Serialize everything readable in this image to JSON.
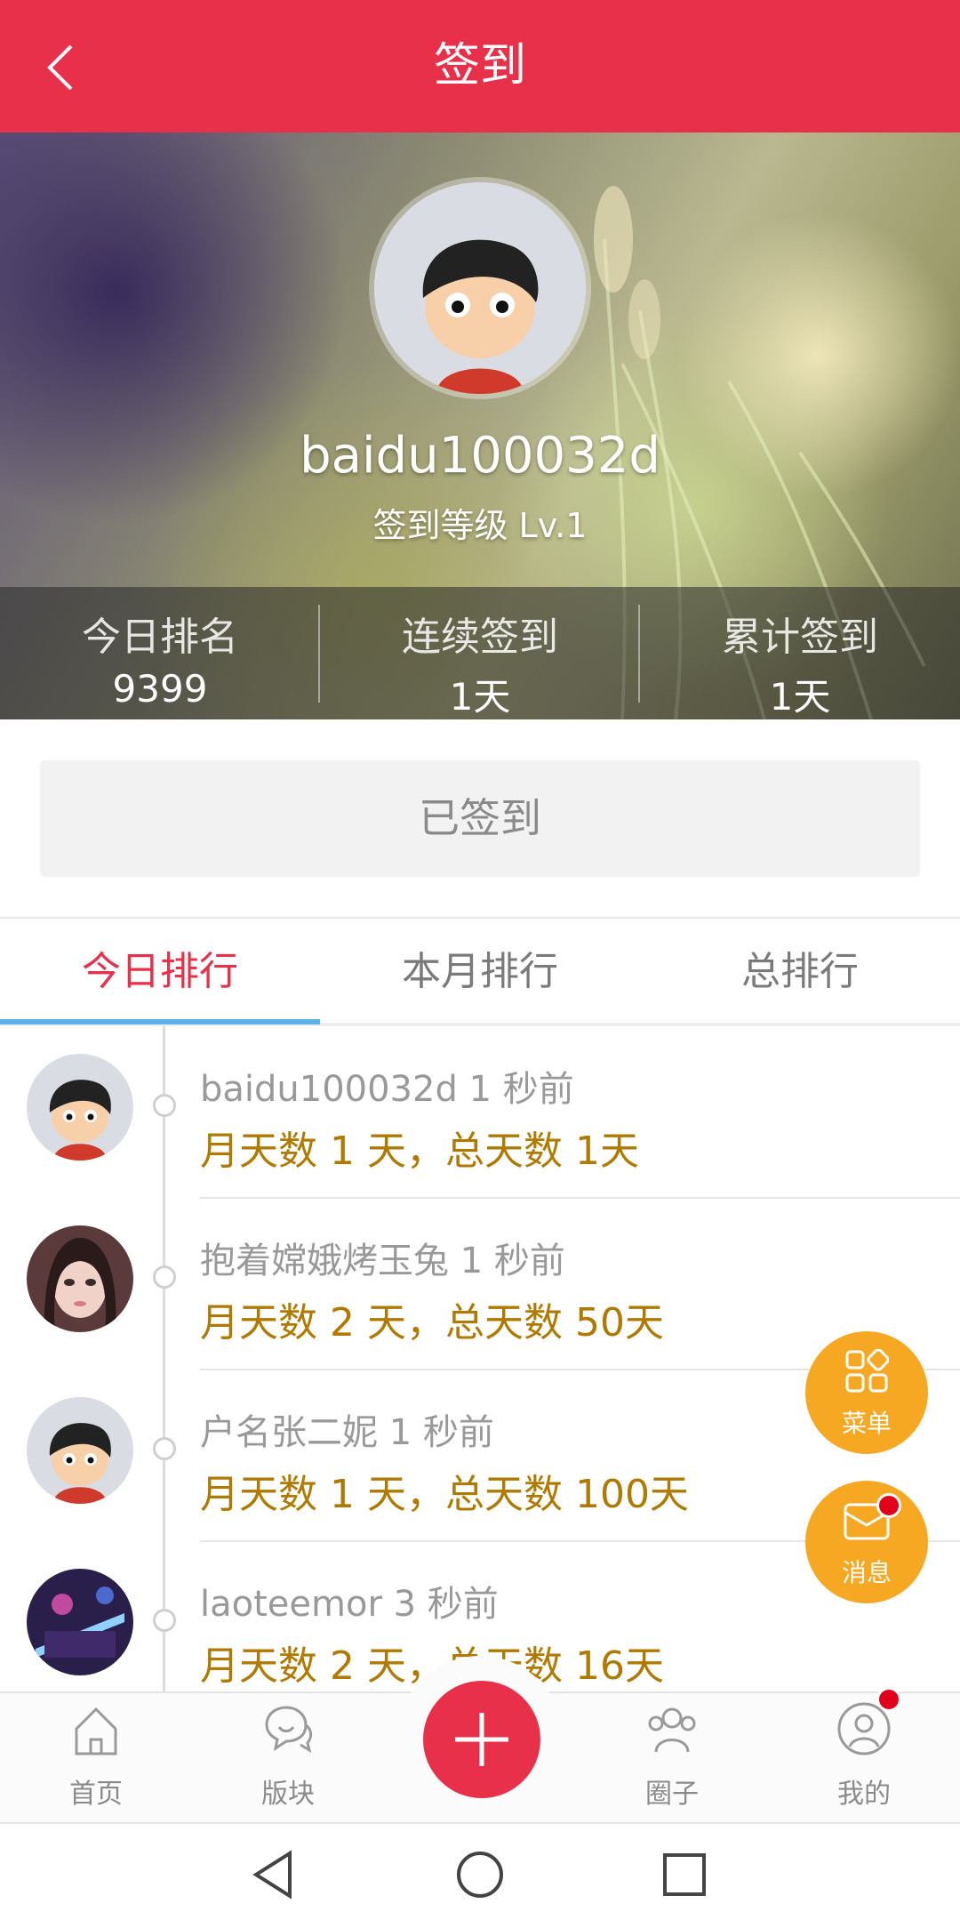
{
  "header": {
    "title": "签到"
  },
  "profile": {
    "username": "baidu100032d",
    "level": "签到等级 Lv.1"
  },
  "stats": [
    {
      "label": "今日排名",
      "value": "9399"
    },
    {
      "label": "连续签到",
      "value": "1天"
    },
    {
      "label": "累计签到",
      "value": "1天"
    }
  ],
  "sign_button": {
    "label": "已签到"
  },
  "tabs": [
    {
      "label": "今日排行"
    },
    {
      "label": "本月排行"
    },
    {
      "label": "总排行"
    }
  ],
  "rankings": [
    {
      "name": "baidu100032d 1 秒前",
      "detail": "月天数 1 天，总天数 1天"
    },
    {
      "name": "抱着嫦娥烤玉兔 1 秒前",
      "detail": "月天数 2 天，总天数 50天"
    },
    {
      "name": "户名张二妮 1 秒前",
      "detail": "月天数 1 天，总天数 100天"
    },
    {
      "name": "laoteemor 3 秒前",
      "detail": "月天数 2 天，总天数 16天"
    }
  ],
  "fabs": {
    "menu": "菜单",
    "messages": "消息"
  },
  "nav": [
    {
      "label": "首页"
    },
    {
      "label": "版块"
    },
    {
      "label": "圈子"
    },
    {
      "label": "我的"
    }
  ],
  "colors": {
    "brand": "#e8304a",
    "accent_tab_underline": "#5bb1e8",
    "fab": "#f7a823",
    "detail_text": "#b07a00"
  },
  "icons": [
    "back-icon",
    "home-icon",
    "chat-icon",
    "add-icon",
    "group-icon",
    "profile-icon",
    "menu-grid-icon",
    "mail-icon",
    "back-triangle-icon",
    "home-circle-icon",
    "recent-square-icon"
  ]
}
